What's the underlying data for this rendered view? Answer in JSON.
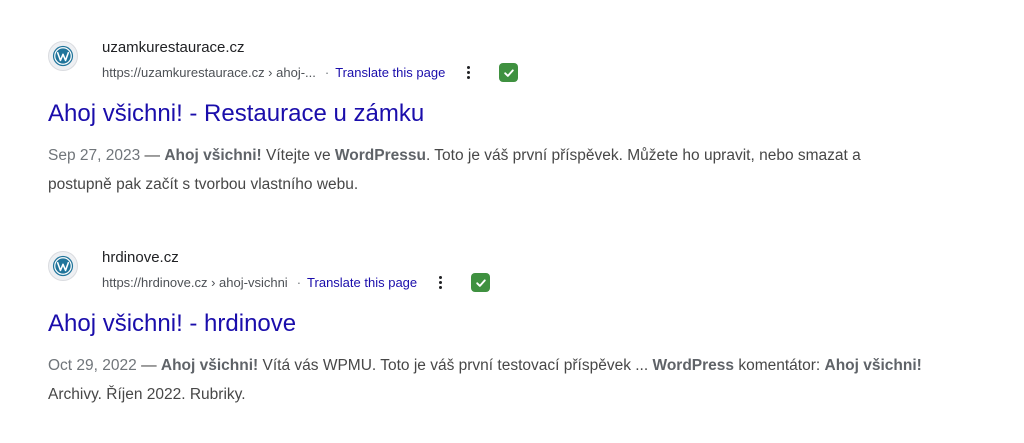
{
  "results": [
    {
      "favicon_icon": "wordpress-icon",
      "site_name": "uzamkurestaurace.cz",
      "url": "https://uzamkurestaurace.cz › ahoj-...",
      "separator": "·",
      "translate_label": "Translate this page",
      "more_icon": "three-dot-menu-icon",
      "badge_icon": "check-icon",
      "badge_color": "#3f9140",
      "title": "Ahoj všichni! - Restaurace u zámku",
      "snippet": {
        "date": "Sep 27, 2023",
        "dash": " — ",
        "b1": "Ahoj všichni!",
        "t1": " Vítejte ve ",
        "b2": "WordPressu",
        "t2": ". Toto je váš první příspěvek. Můžete ho upravit, nebo smazat a postupně pak začít s tvorbou vlastního webu."
      }
    },
    {
      "favicon_icon": "wordpress-icon",
      "site_name": "hrdinove.cz",
      "url": "https://hrdinove.cz › ahoj-vsichni",
      "separator": "·",
      "translate_label": "Translate this page",
      "more_icon": "three-dot-menu-icon",
      "badge_icon": "check-icon",
      "badge_color": "#3f9140",
      "title": "Ahoj všichni! - hrdinove",
      "snippet": {
        "date": "Oct 29, 2022",
        "dash": " — ",
        "b1": "Ahoj všichni!",
        "t1": " Vítá vás WPMU. Toto je váš první testovací příspěvek ... ",
        "b2": "WordPress",
        "t2": " komentátor: ",
        "b3": "Ahoj všichni!",
        "t3": " Archivy. Říjen 2022. Rubriky."
      }
    }
  ],
  "colors": {
    "link": "#1a0dab",
    "url": "#4d5156",
    "snippet": "#474747"
  }
}
